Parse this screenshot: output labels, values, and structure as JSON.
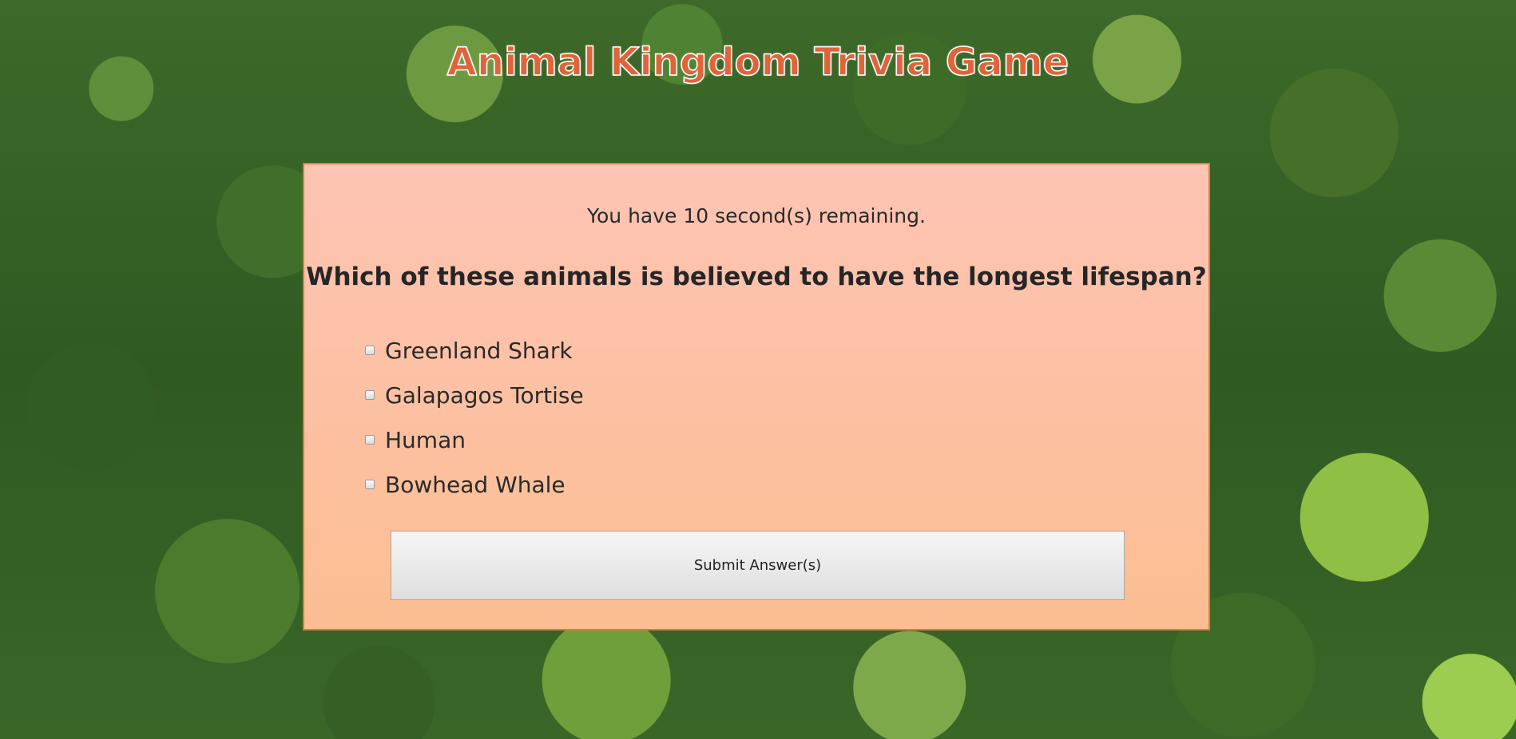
{
  "app": {
    "title": "Animal Kingdom Trivia Game"
  },
  "quiz": {
    "timer_text": "You have 10 second(s) remaining.",
    "question": "Which of these animals is believed to have the longest lifespan?",
    "options": [
      {
        "label": "Greenland Shark",
        "checked": false
      },
      {
        "label": "Galapagos Tortise",
        "checked": false
      },
      {
        "label": "Human",
        "checked": false
      },
      {
        "label": "Bowhead Whale",
        "checked": false
      }
    ],
    "submit_label": "Submit Answer(s)"
  },
  "colors": {
    "title": "#e0643a",
    "panel_border": "#e07a3e",
    "panel_top": "#fec4b4",
    "panel_bottom": "#fbbe92"
  }
}
